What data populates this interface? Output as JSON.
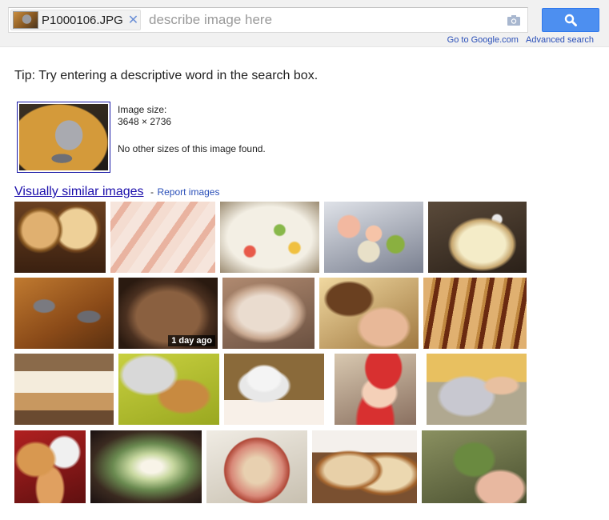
{
  "search": {
    "file_name": "P1000106.JPG",
    "placeholder": "describe image here",
    "value": ""
  },
  "header_links": {
    "go_to_google": "Go to Google.com",
    "advanced_search": "Advanced search"
  },
  "tip": "Tip: Try entering a descriptive word in the search box.",
  "image_info": {
    "size_label": "Image size:",
    "size_value": "3648 × 2736",
    "other_sizes": "No other sizes of this image found."
  },
  "similar": {
    "title": "Visually similar images",
    "separator": "-",
    "report_label": "Report images"
  },
  "similar_thumbs": [
    {
      "name": "thumb-bread-pies"
    },
    {
      "name": "thumb-sliced-fish"
    },
    {
      "name": "thumb-rice-salad"
    },
    {
      "name": "thumb-shrimp-plate"
    },
    {
      "name": "thumb-cream-dessert"
    },
    {
      "name": "thumb-baked-fish"
    },
    {
      "name": "thumb-pan-stew",
      "badge": "1 day ago"
    },
    {
      "name": "thumb-sleeping-cat"
    },
    {
      "name": "thumb-dog-and-man"
    },
    {
      "name": "thumb-baguettes"
    },
    {
      "name": "thumb-layered-cake"
    },
    {
      "name": "thumb-dog-with-person"
    },
    {
      "name": "thumb-cup-and-saucer"
    },
    {
      "name": "thumb-child-red-hat"
    },
    {
      "name": "thumb-person-lying"
    },
    {
      "name": "thumb-kittens"
    },
    {
      "name": "thumb-nebula"
    },
    {
      "name": "thumb-apple"
    },
    {
      "name": "thumb-bread-slices"
    },
    {
      "name": "thumb-toy-frog"
    }
  ]
}
